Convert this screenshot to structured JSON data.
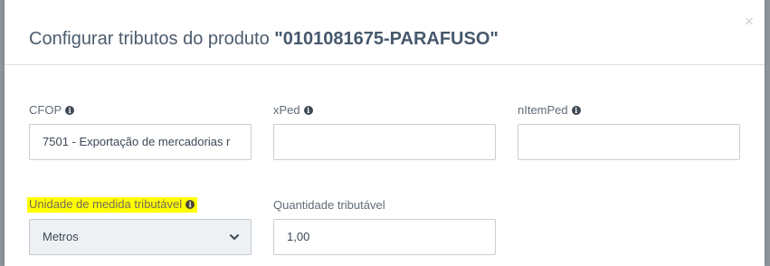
{
  "modal": {
    "title_prefix": "Configurar tributos do produto ",
    "title_product": "\"0101081675-PARAFUSO\"",
    "close_glyph": "×"
  },
  "fields": {
    "cfop": {
      "label": "CFOP",
      "value": "7501 - Exportação de mercadorias r"
    },
    "xped": {
      "label": "xPed",
      "value": ""
    },
    "nitemped": {
      "label": "nItemPed",
      "value": ""
    },
    "unidade": {
      "label": "Unidade de medida tributável",
      "value": "Metros"
    },
    "quantidade": {
      "label": "Quantidade tributável",
      "value": "1,00"
    }
  },
  "icons": {
    "info": "info-circle-icon",
    "close": "close-icon",
    "chevron": "chevron-down-icon"
  },
  "colors": {
    "highlight": "#ffff00",
    "title": "#4c5c6e",
    "backdrop": "#8f9498"
  }
}
